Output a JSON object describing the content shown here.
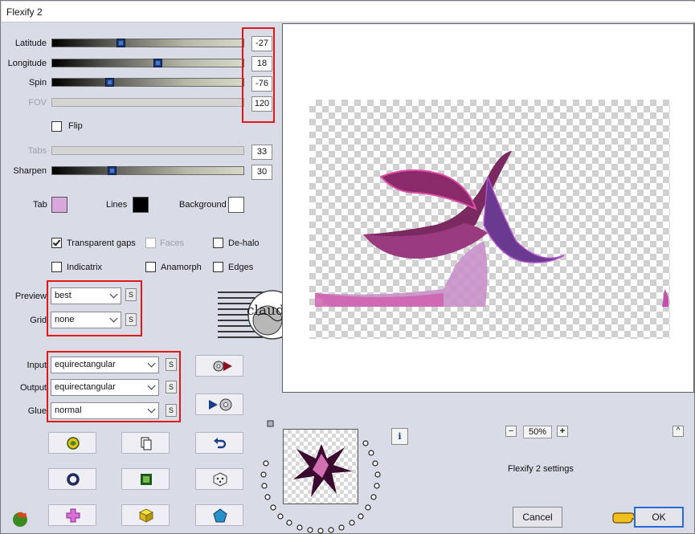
{
  "window": {
    "title": "Flexify 2"
  },
  "sliders": {
    "latitude": {
      "label": "Latitude",
      "value": "-27",
      "enabled": true
    },
    "longitude": {
      "label": "Longitude",
      "value": "18",
      "enabled": true
    },
    "spin": {
      "label": "Spin",
      "value": "-76",
      "enabled": true
    },
    "fov": {
      "label": "FOV",
      "value": "120",
      "enabled": false
    },
    "tabs": {
      "label": "Tabs",
      "value": "33",
      "enabled": false
    },
    "sharpen": {
      "label": "Sharpen",
      "value": "30",
      "enabled": true
    }
  },
  "flip": {
    "label": "Flip",
    "checked": false
  },
  "colors": {
    "tab": {
      "label": "Tab",
      "color": "#d8a8dc"
    },
    "lines": {
      "label": "Lines",
      "color": "#000000"
    },
    "background": {
      "label": "Background",
      "color": "#ffffff"
    }
  },
  "options": {
    "transparent_gaps": {
      "label": "Transparent gaps",
      "checked": true
    },
    "faces": {
      "label": "Faces",
      "checked": false,
      "enabled": false
    },
    "de_halo": {
      "label": "De-halo",
      "checked": false
    },
    "indicatrix": {
      "label": "Indicatrix",
      "checked": false
    },
    "anamorph": {
      "label": "Anamorph",
      "checked": false
    },
    "edges": {
      "label": "Edges",
      "checked": false
    }
  },
  "dropdowns": {
    "preview": {
      "label": "Preview",
      "value": "best"
    },
    "grid": {
      "label": "Grid",
      "value": "none"
    },
    "input": {
      "label": "Input",
      "value": "equirectangular"
    },
    "output": {
      "label": "Output",
      "value": "equirectangular"
    },
    "glue": {
      "label": "Glue",
      "value": "normal"
    }
  },
  "s_button_label": "S",
  "watermark": {
    "text": "claudia"
  },
  "zoom": {
    "minus": "−",
    "value": "50%",
    "plus": "+"
  },
  "collapse_label": "^",
  "info_label": "i",
  "status_text": "Flexify 2 settings",
  "buttons": {
    "cancel": "Cancel",
    "ok": "OK"
  },
  "accent_color": "#e01818",
  "toolbar_icons": [
    "randomize-icon",
    "copy-icon",
    "undo-icon",
    "ring-icon",
    "frame-icon",
    "dice-icon",
    "cross-icon",
    "cube-icon",
    "pentagon-icon"
  ]
}
